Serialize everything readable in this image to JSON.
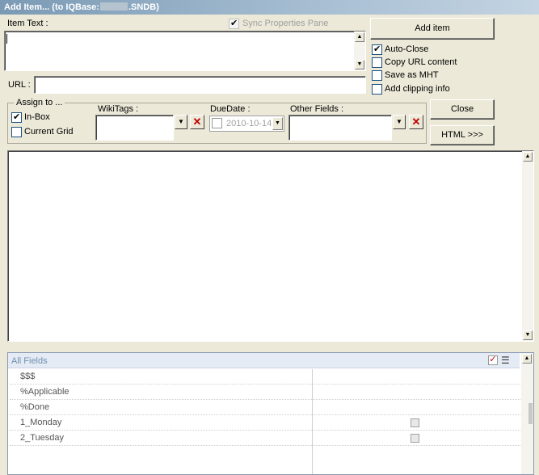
{
  "window": {
    "title_prefix": "Add Item... (to IQBase:",
    "title_suffix": ".SNDB)"
  },
  "item_text": {
    "label": "Item Text :",
    "value": ""
  },
  "sync_pane": {
    "label": "Sync Properties Pane",
    "checked": true
  },
  "url": {
    "label": "URL :",
    "value": ""
  },
  "buttons": {
    "add_item": "Add item",
    "close": "Close",
    "html": "HTML >>>"
  },
  "options": [
    {
      "label": "Auto-Close",
      "checked": true
    },
    {
      "label": "Copy URL content",
      "checked": false
    },
    {
      "label": "Save as MHT",
      "checked": false
    },
    {
      "label": "Add clipping info",
      "checked": false
    }
  ],
  "assign_to": {
    "label": "Assign to ...",
    "inbox": {
      "label": "In-Box",
      "checked": true
    },
    "current_grid": {
      "label": "Current Grid",
      "checked": false
    }
  },
  "wikitags": {
    "label": "WikiTags :",
    "value": ""
  },
  "duedate": {
    "label": "DueDate :",
    "value": "2010-10-14",
    "checked": false
  },
  "other_fields": {
    "label": "Other Fields :",
    "value": ""
  },
  "fields_grid": {
    "header": "All Fields",
    "rows": [
      {
        "name": "$$$",
        "has_checkbox": false
      },
      {
        "name": "%Applicable",
        "has_checkbox": false
      },
      {
        "name": "%Done",
        "has_checkbox": false
      },
      {
        "name": "1_Monday",
        "has_checkbox": true
      },
      {
        "name": "2_Tuesday",
        "has_checkbox": true
      }
    ]
  },
  "icons": {
    "dropdown": "chevron-down-icon",
    "clear": "red-x-icon",
    "check_all": "check-icon",
    "list": "list-icon"
  },
  "colors": {
    "title_gradient_start": "#7b9ab5",
    "grid_header_text": "#6f8fb0",
    "clear_x": "#c00000"
  }
}
